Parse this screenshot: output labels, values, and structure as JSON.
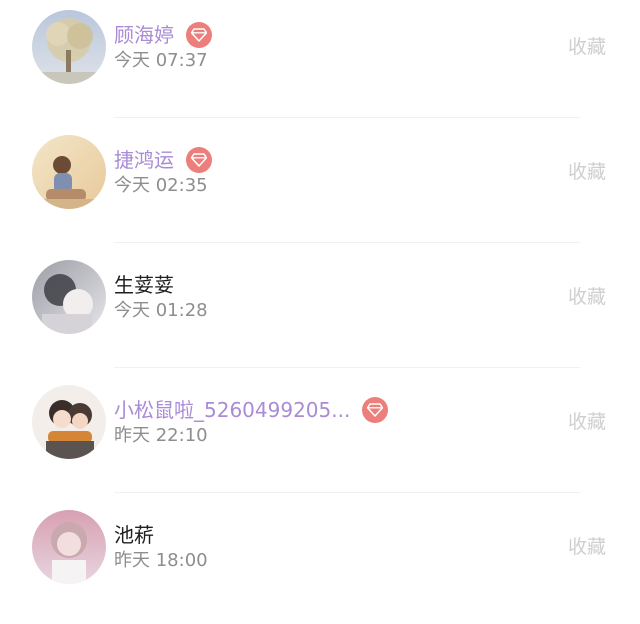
{
  "fav_label": "收藏",
  "colors": {
    "vip_name": "#a98bd6",
    "normal_name": "#1f1f1f",
    "time": "#8e8e8e",
    "fav": "#cfcfcf",
    "badge": "#ec7f7b"
  },
  "users": [
    {
      "name": "顾海婷",
      "time": "今天 07:37",
      "vip": true,
      "badge_icon": "diamond-icon"
    },
    {
      "name": "捷鸿运",
      "time": "今天 02:35",
      "vip": true,
      "badge_icon": "diamond-icon"
    },
    {
      "name": "生荽荽",
      "time": "今天 01:28",
      "vip": false
    },
    {
      "name": "小松鼠啦_5260499205...",
      "time": "昨天 22:10",
      "vip": true,
      "badge_icon": "diamond-icon"
    },
    {
      "name": "池菥",
      "time": "昨天 18:00",
      "vip": false
    }
  ]
}
